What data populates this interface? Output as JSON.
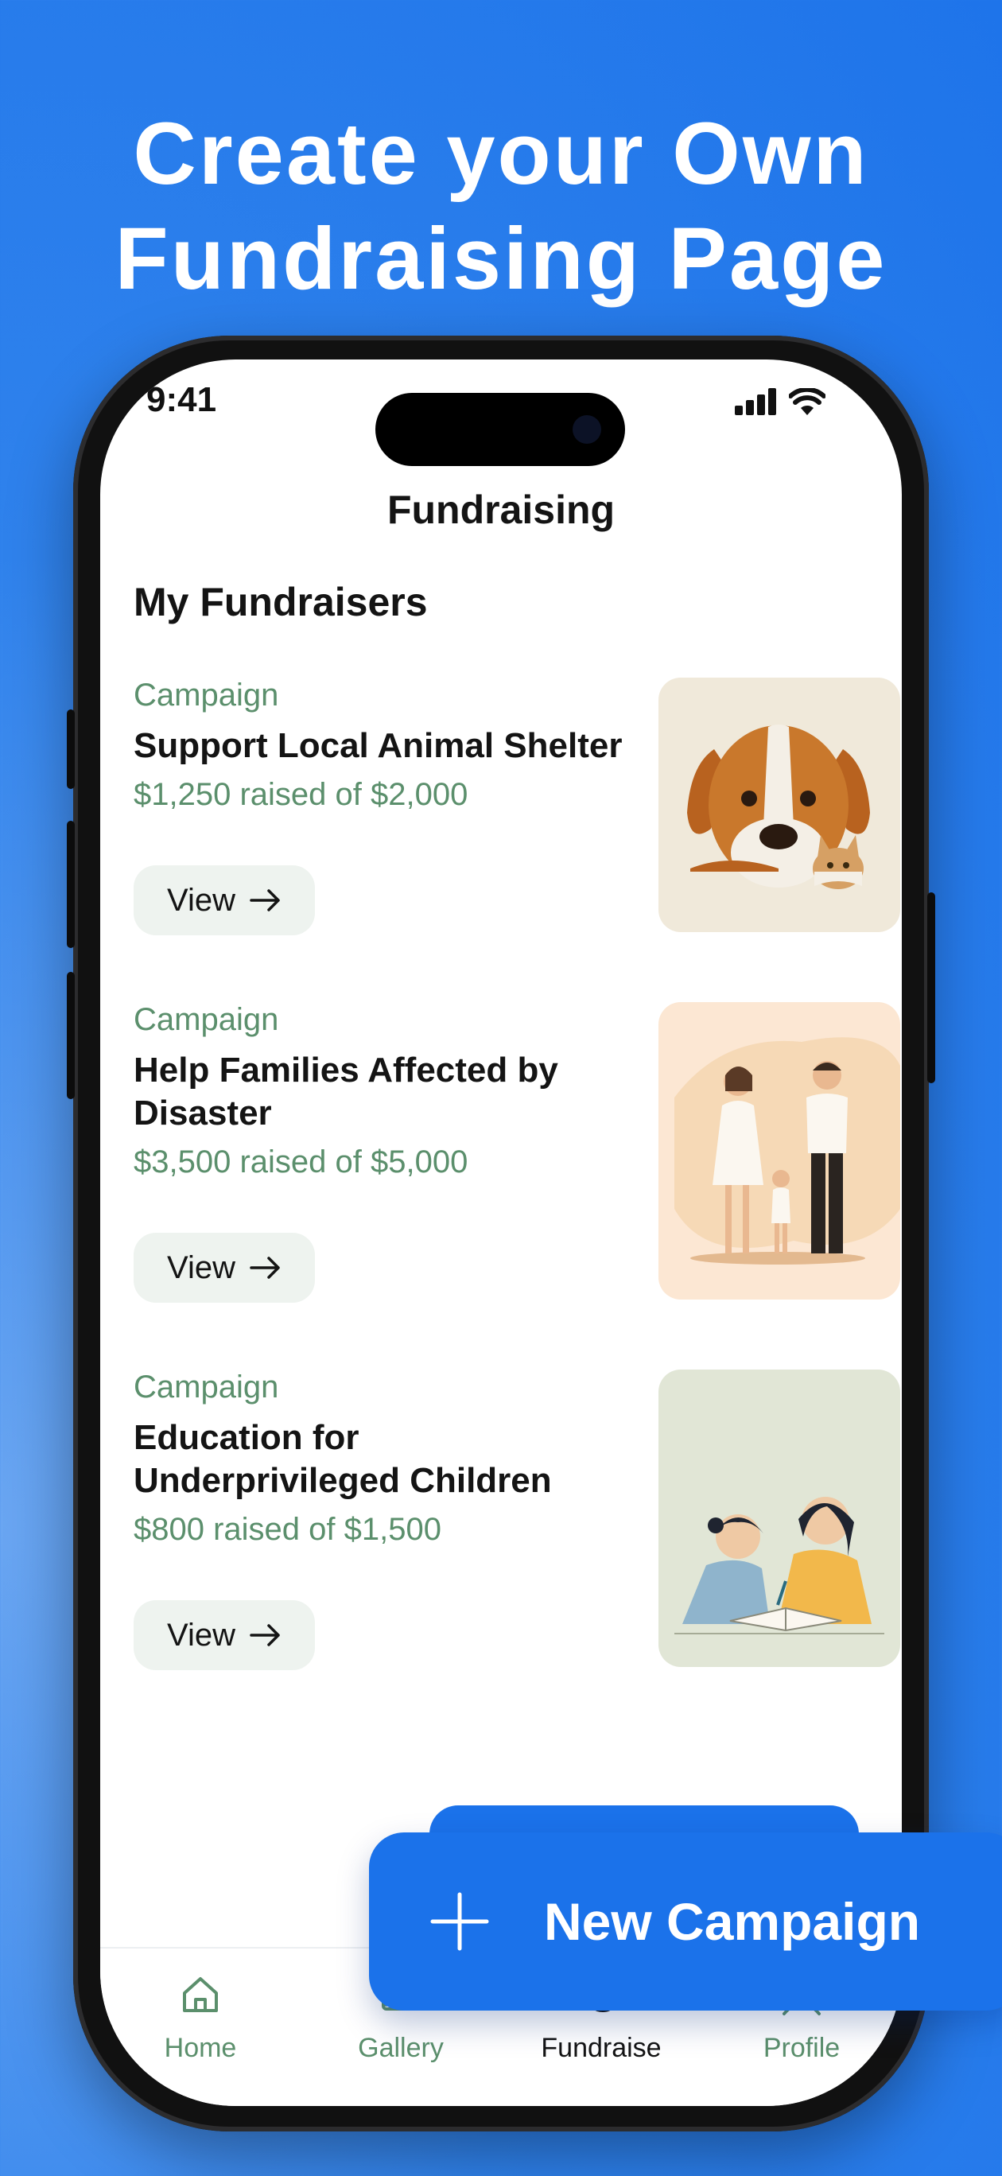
{
  "headline": {
    "line1": "Create your Own",
    "line2": "Fundraising Page"
  },
  "status_bar": {
    "time": "9:41"
  },
  "nav": {
    "title": "Fundraising"
  },
  "section": {
    "title": "My Fundraisers"
  },
  "campaigns": [
    {
      "kind": "Campaign",
      "name": "Support Local Animal Shelter",
      "raised": "$1,250 raised of $2,000",
      "button": "View",
      "image_icon": "dog-and-cat-illustration"
    },
    {
      "kind": "Campaign",
      "name": "Help Families Affected by Disaster",
      "raised": "$3,500 raised of $5,000",
      "button": "View",
      "image_icon": "family-illustration"
    },
    {
      "kind": "Campaign",
      "name": "Education for Underprivileged Children",
      "raised": "$800 raised of $1,500",
      "button": "View",
      "image_icon": "children-studying-illustration"
    }
  ],
  "fab": {
    "label": "New Campaign"
  },
  "tabs": [
    {
      "label": "Home",
      "icon": "home-icon"
    },
    {
      "label": "Gallery",
      "icon": "gallery-icon"
    },
    {
      "label": "Fundraise",
      "icon": "hand-heart-icon",
      "active": true
    },
    {
      "label": "Profile",
      "icon": "profile-icon"
    }
  ],
  "colors": {
    "background": "#1e74ea",
    "accent": "#1b72ea",
    "muted_green": "#5b8f6c",
    "button_bg": "#eef3ef"
  }
}
